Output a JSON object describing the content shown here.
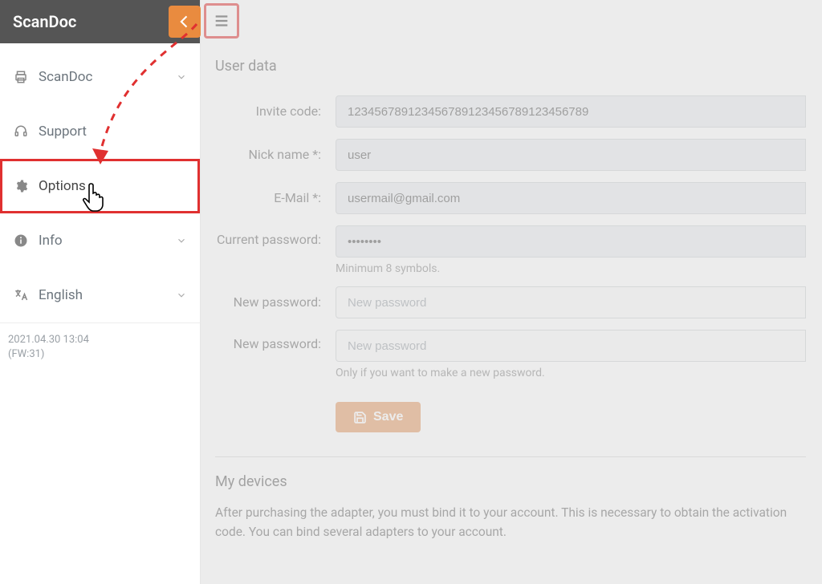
{
  "app": {
    "title": "ScanDoc"
  },
  "sidebar": {
    "items": [
      {
        "label": "ScanDoc",
        "icon": "printer-icon",
        "expandable": true
      },
      {
        "label": "Support",
        "icon": "headset-icon",
        "expandable": false
      },
      {
        "label": "Options",
        "icon": "gear-icon",
        "expandable": false
      },
      {
        "label": "Info",
        "icon": "info-icon",
        "expandable": true
      },
      {
        "label": "English",
        "icon": "language-icon",
        "expandable": true
      }
    ],
    "footer": {
      "timestamp": "2021.04.30 13:04",
      "firmware": "(FW:31)"
    }
  },
  "form": {
    "section_title": "User data",
    "invite_label": "Invite code:",
    "invite_value": "123456789123456789123456789123456789",
    "nick_label": "Nick name *:",
    "nick_value": "user",
    "email_label": "E-Mail *:",
    "email_value": "usermail@gmail.com",
    "curpass_label": "Current password:",
    "curpass_value": "••••••••",
    "curpass_hint": "Minimum 8 symbols.",
    "newpass1_label": "New password:",
    "newpass1_placeholder": "New password",
    "newpass2_label": "New password:",
    "newpass2_placeholder": "New password",
    "newpass_hint": "Only if you want to make a new password.",
    "save_label": "Save"
  },
  "devices": {
    "title": "My devices",
    "text": "After purchasing the adapter, you must bind it to your account. This is necessary to obtain the activation code. You can bind several adapters to your account."
  }
}
